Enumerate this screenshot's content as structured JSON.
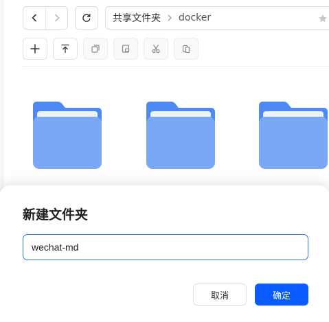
{
  "nav": {
    "back_icon": "chevron-left-icon",
    "forward_icon": "chevron-right-icon",
    "refresh_icon": "refresh-icon"
  },
  "breadcrumb": {
    "items": [
      "共享文件夹",
      "docker"
    ],
    "favorite_icon": "star-icon"
  },
  "toolbar": {
    "icons": [
      "plus-icon",
      "upload-icon",
      "copy-icon",
      "move-icon",
      "cut-icon",
      "paste-icon"
    ]
  },
  "folders": [
    {
      "name": "",
      "icon": "folder-icon"
    },
    {
      "name": "",
      "icon": "folder-icon"
    },
    {
      "name": "",
      "icon": "folder-icon"
    }
  ],
  "dialog": {
    "title": "新建文件夹",
    "input_value": "wechat-md",
    "cancel_label": "取消",
    "confirm_label": "确定"
  },
  "colors": {
    "primary": "#0a5bff",
    "folder": "#6f9ff5",
    "folder_tab": "#4e8af2"
  }
}
